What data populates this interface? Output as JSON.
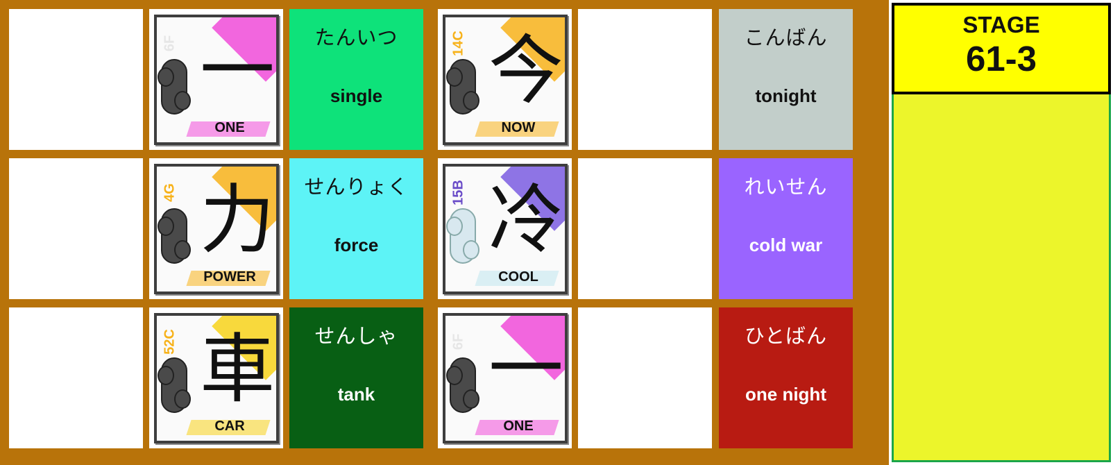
{
  "stage": {
    "title": "STAGE",
    "number": "61-3"
  },
  "rows": [
    {
      "kanji1": {
        "char": "一",
        "grade": "6F",
        "meaning": "ONE",
        "accent": "#f04bd8",
        "grade_color": "#e6e6e6"
      },
      "word1": {
        "reading": "たんいつ",
        "meaning": "single",
        "bg": "#0ee27a",
        "fg": "#111111"
      },
      "kanji2": {
        "char": "今",
        "grade": "14C",
        "meaning": "NOW",
        "accent": "#f7b21a",
        "grade_color": "#f7b21a"
      },
      "word2": {
        "reading": "こんばん",
        "meaning": "tonight",
        "bg": "#c2ceca",
        "fg": "#111111"
      }
    },
    {
      "kanji1": {
        "char": "力",
        "grade": "4G",
        "meaning": "POWER",
        "accent": "#f7b21a",
        "grade_color": "#f7b21a"
      },
      "word1": {
        "reading": "せんりょく",
        "meaning": "force",
        "bg": "#5df3f6",
        "fg": "#111111"
      },
      "kanji2": {
        "char": "冷",
        "grade": "15B",
        "meaning": "COOL",
        "accent": "#7a5ce0",
        "grade_color": "#6a4cc8"
      },
      "word2": {
        "reading": "れいせん",
        "meaning": "cold war",
        "bg": "#9a64ff",
        "fg": "#ffffff"
      }
    },
    {
      "kanji1": {
        "char": "車",
        "grade": "52C",
        "meaning": "CAR",
        "accent": "#f7d21a",
        "grade_color": "#f7b21a"
      },
      "word1": {
        "reading": "せんしゃ",
        "meaning": "tank",
        "bg": "#085f14",
        "fg": "#ffffff"
      },
      "kanji2": {
        "char": "一",
        "grade": "6F",
        "meaning": "ONE",
        "accent": "#f04bd8",
        "grade_color": "#e6e6e6"
      },
      "word2": {
        "reading": "ひとばん",
        "meaning": "one night",
        "bg": "#b81b12",
        "fg": "#ffffff"
      }
    }
  ]
}
